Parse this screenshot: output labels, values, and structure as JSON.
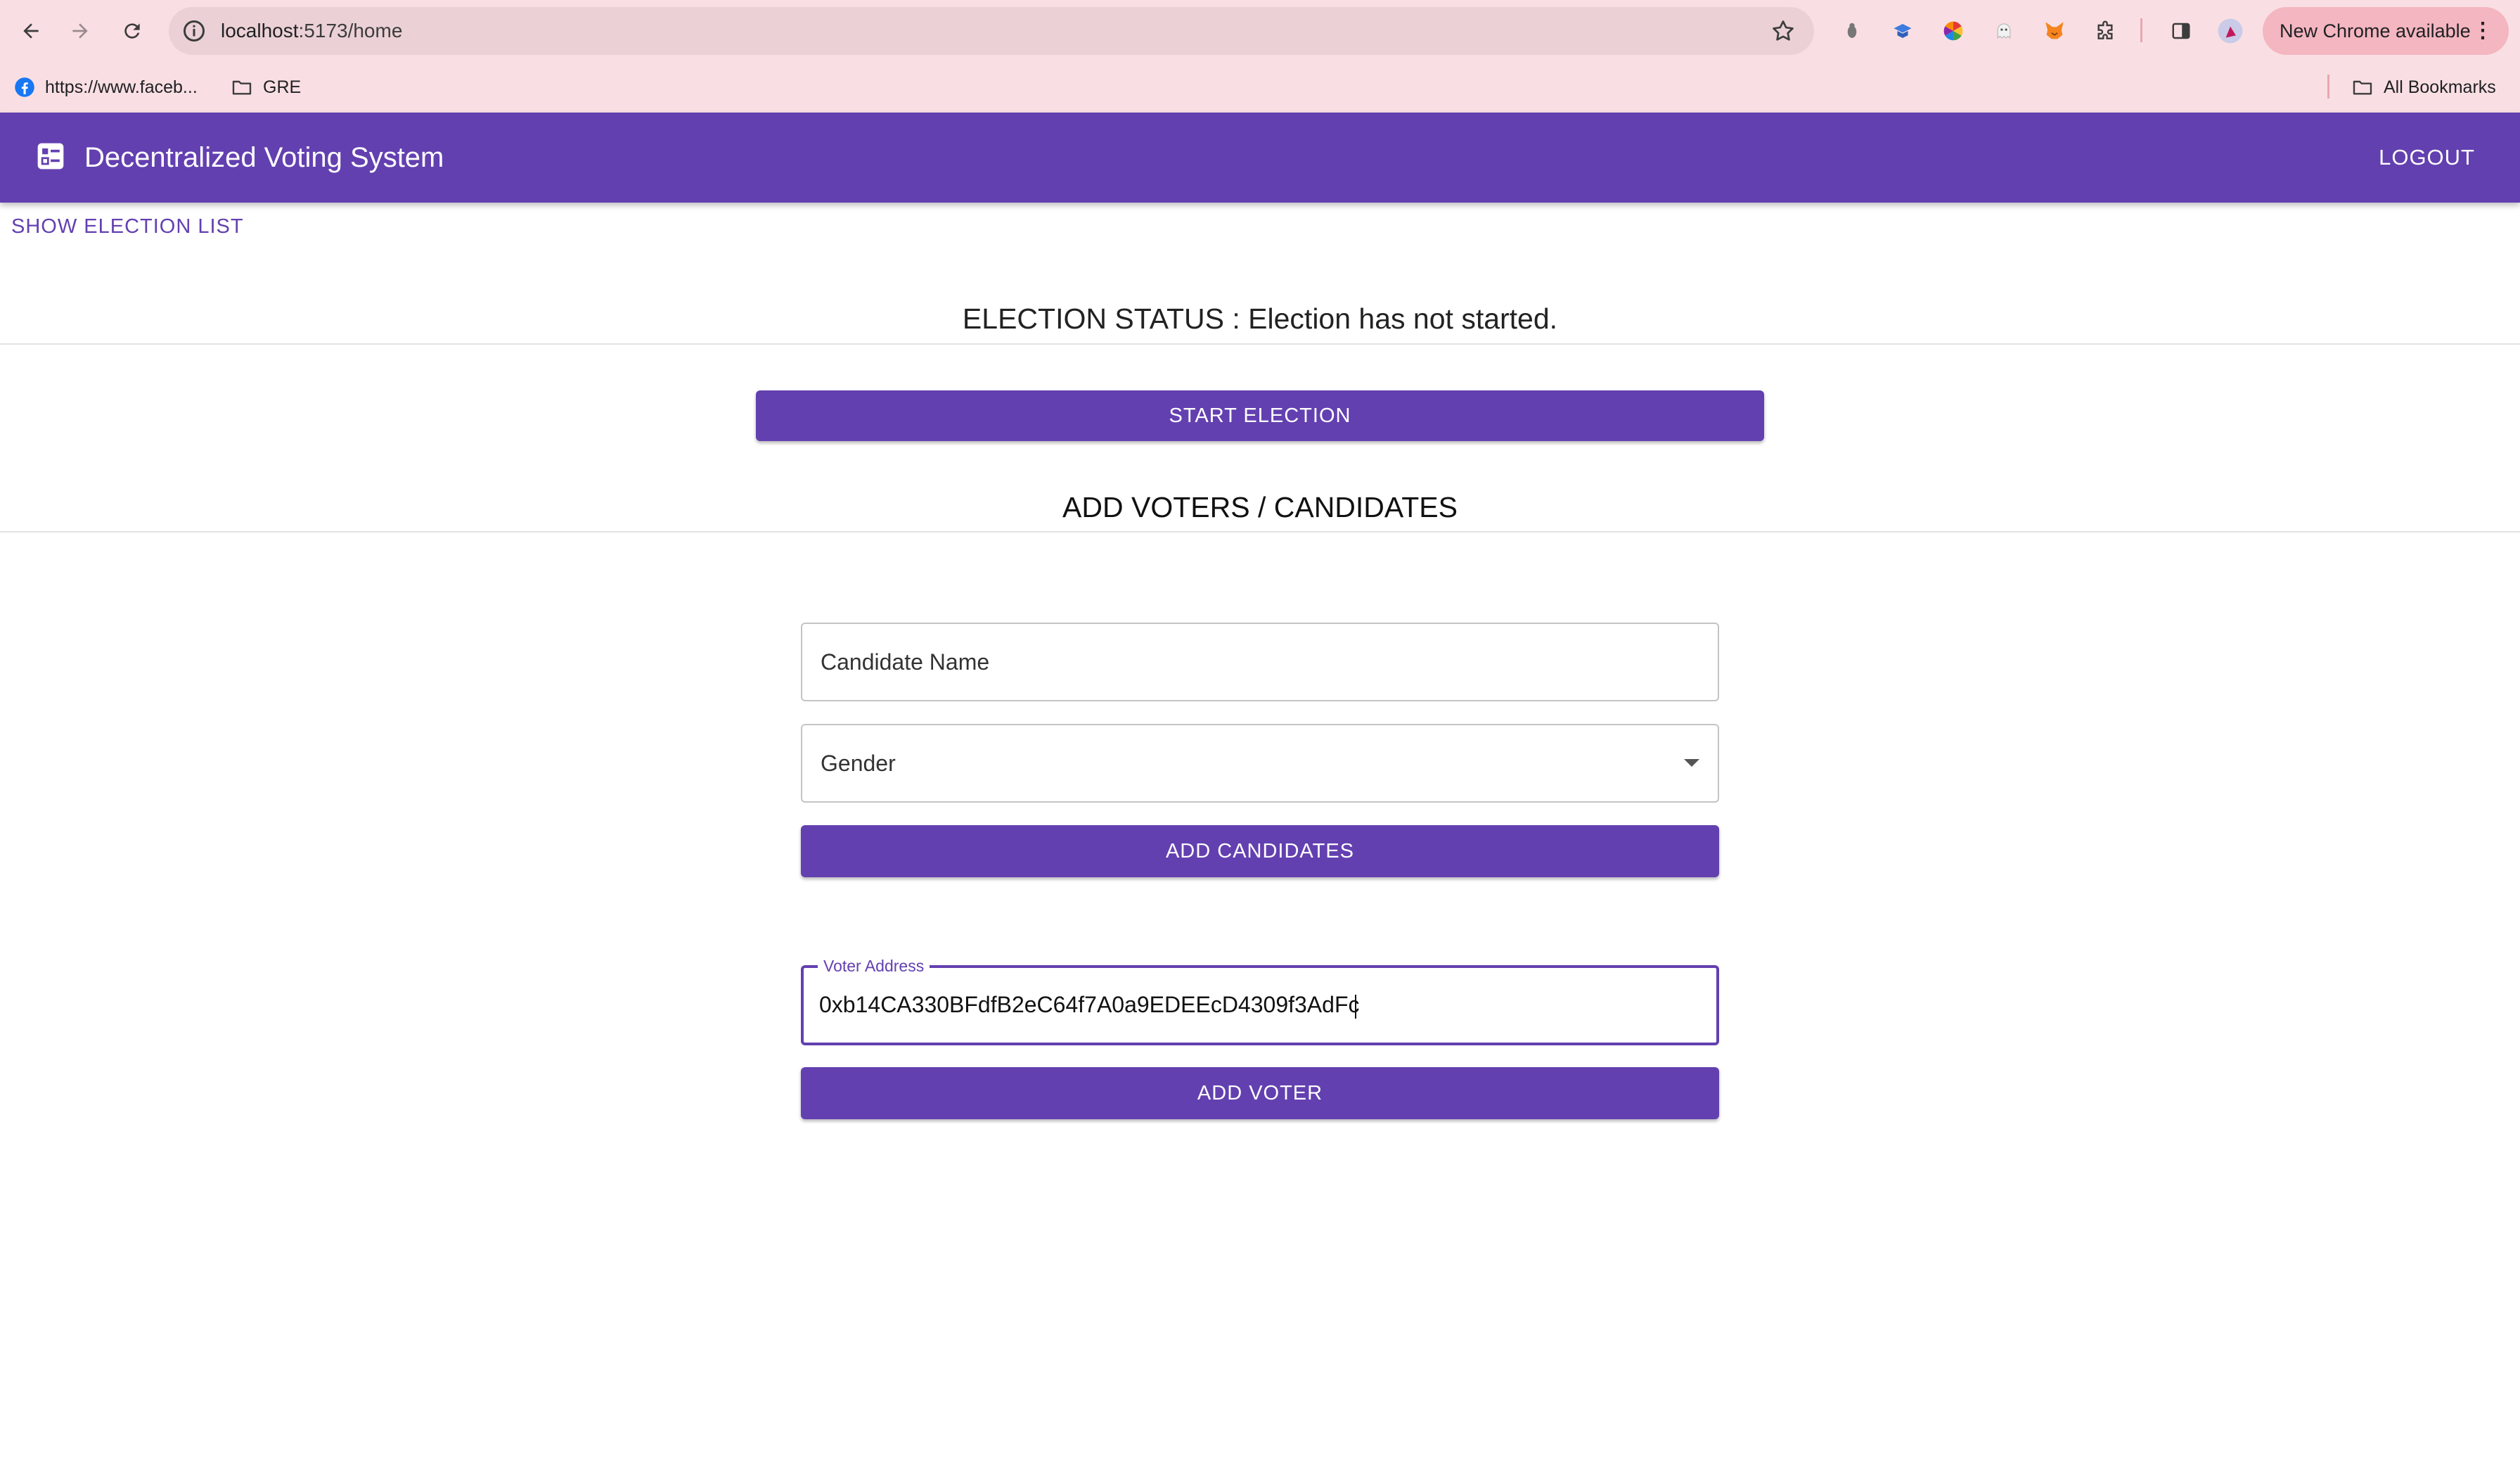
{
  "browser": {
    "url_host": "localhost",
    "url_path": ":5173/home",
    "new_chrome_label": "New Chrome available",
    "bookmarks": [
      {
        "label": "https://www.faceb..."
      },
      {
        "label": "GRE"
      }
    ],
    "all_bookmarks_label": "All Bookmarks"
  },
  "appbar": {
    "title": "Decentralized Voting System",
    "logout_label": "LOGOUT"
  },
  "main": {
    "show_election_list_label": "SHOW ELECTION LIST",
    "election_status_text": "ELECTION STATUS : Election has not started.",
    "start_election_label": "START ELECTION",
    "section_title": "ADD VOTERS / CANDIDATES",
    "candidate_name_placeholder": "Candidate Name",
    "gender_placeholder": "Gender",
    "add_candidates_label": "ADD CANDIDATES",
    "voter_address_label": "Voter Address",
    "voter_address_value": "0xb14CA330BFdfB2eC64f7A0a9EDEEcD4309f3AdFc",
    "add_voter_label": "ADD VOTER"
  },
  "colors": {
    "primary": "#6340b0",
    "browser_bg": "#f9dfe3"
  }
}
